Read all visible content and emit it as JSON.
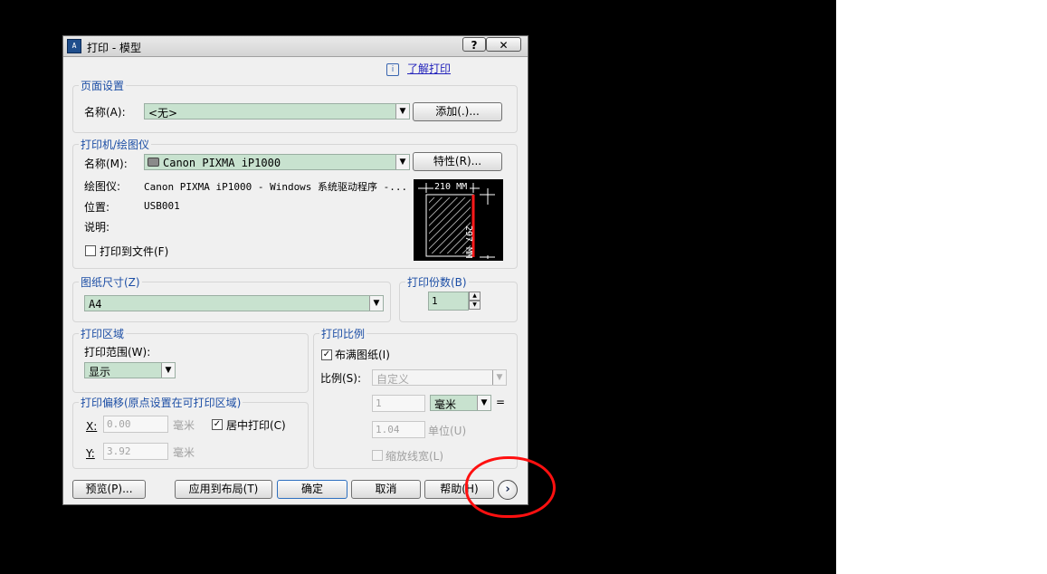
{
  "window": {
    "app_icon": "autocad-icon",
    "app_icon_text": "A",
    "title": "打印 - 模型",
    "help_button": "?",
    "close_button": "✕"
  },
  "learn_link": {
    "icon": "info-icon",
    "icon_text": "i",
    "label": "了解打印"
  },
  "page_setup": {
    "legend": "页面设置",
    "name_label": "名称(A):",
    "name_value": "<无>",
    "add_button": "添加(.)..."
  },
  "printer": {
    "legend": "打印机/绘图仪",
    "name_label": "名称(M):",
    "printer_icon": "printer-icon",
    "name_value": "Canon PIXMA iP1000",
    "properties_button": "特性(R)...",
    "plotter_label": "绘图仪:",
    "plotter_value": "Canon PIXMA iP1000 - Windows 系统驱动程序 -...",
    "location_label": "位置:",
    "location_value": "USB001",
    "description_label": "说明:",
    "print_to_file_label": "打印到文件(F)",
    "print_to_file_checked": false,
    "paper_preview": {
      "width_label": "210 MM",
      "height_label": "297 MM"
    }
  },
  "paper_size": {
    "legend": "图纸尺寸(Z)",
    "value": "A4"
  },
  "copies": {
    "legend": "打印份数(B)",
    "value": "1"
  },
  "plot_area": {
    "legend": "打印区域",
    "what_to_plot_label": "打印范围(W):",
    "what_to_plot_value": "显示"
  },
  "plot_offset": {
    "legend": "打印偏移(原点设置在可打印区域)",
    "x_label": "X:",
    "x_value": "0.00",
    "x_unit": "毫米",
    "y_label": "Y:",
    "y_value": "3.92",
    "y_unit": "毫米",
    "center_label": "居中打印(C)",
    "center_checked": true
  },
  "plot_scale": {
    "legend": "打印比例",
    "fit_label": "布满图纸(I)",
    "fit_checked": true,
    "scale_label": "比例(S):",
    "scale_value": "自定义",
    "value1": "1",
    "unit_value": "毫米",
    "equals": "=",
    "value2": "1.04",
    "unit_label": "单位(U)",
    "lineweights_label": "缩放线宽(L)",
    "lineweights_checked": false
  },
  "buttons": {
    "preview": "预览(P)...",
    "apply_to_layout": "应用到布局(T)",
    "ok": "确定",
    "cancel": "取消",
    "help": "帮助(H)",
    "more_options": "›"
  },
  "annotation_color": "#ff1010"
}
